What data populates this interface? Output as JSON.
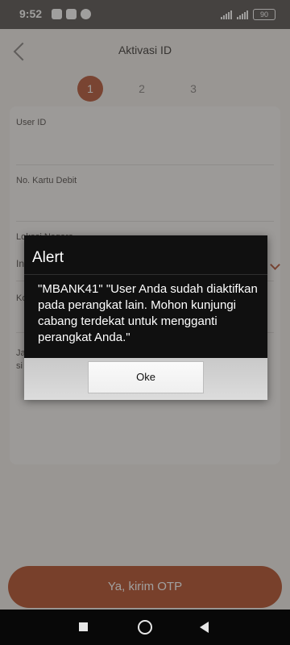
{
  "status": {
    "time": "9:52",
    "battery": "90"
  },
  "header": {
    "title": "Aktivasi ID"
  },
  "stepper": {
    "steps": [
      "1",
      "2",
      "3"
    ]
  },
  "form": {
    "user_id_label": "User ID",
    "debit_card_label": "No. Kartu Debit",
    "location_label": "Lokasi Negara",
    "location_value_fragment": "In",
    "ko_label_fragment": "Ko",
    "note_fragment_1": "Ja",
    "note_fragment_2": "si"
  },
  "actions": {
    "send_otp": "Ya, kirim OTP"
  },
  "alert": {
    "title": "Alert",
    "message": "\"MBANK41\" \"User Anda sudah diaktifkan pada perangkat lain. Mohon kunjungi cabang terdekat untuk mengganti perangkat Anda.\"",
    "ok_label": "Oke"
  }
}
